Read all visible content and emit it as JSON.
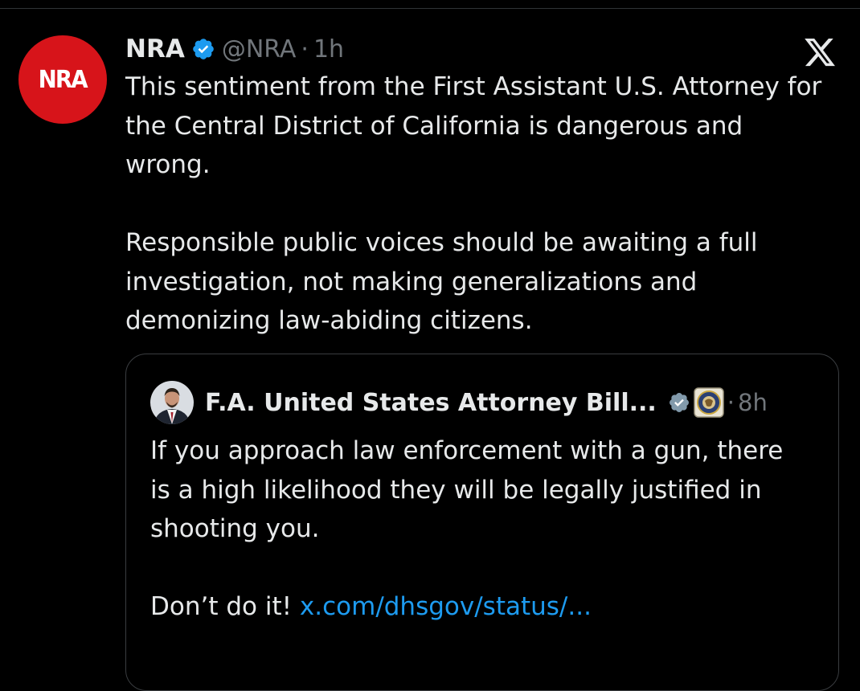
{
  "tweet": {
    "avatar_text": "NRA",
    "author_name": "NRA",
    "handle": "@NRA",
    "separator": "·",
    "time": "1h",
    "paragraphs": [
      "This sentiment from the First Assistant U.S. Attorney for the Central District of California is dangerous and wrong.",
      "Responsible public voices should be awaiting a full investigation, not making generalizations and demonizing law-abiding citizens."
    ]
  },
  "quoted": {
    "author_name": "F.A. United States Attorney Bill...",
    "time_prefix": "·",
    "time": "8h",
    "paragraph_1": "If you approach law enforcement with a gun, there is a high likelihood they will be legally justified in shooting you.",
    "paragraph_2_text": "Don’t do it! ",
    "paragraph_2_link": "x.com/dhsgov/status/..."
  },
  "icons": {
    "verified": "verified-badge-icon",
    "affiliation": "doj-seal-icon",
    "brand": "x-logo-icon"
  },
  "colors": {
    "background": "#000000",
    "text": "#e7e9ea",
    "muted": "#71767b",
    "link": "#1d9bf0",
    "verified": "#1d9bf0",
    "nra_red": "#d7141a"
  }
}
